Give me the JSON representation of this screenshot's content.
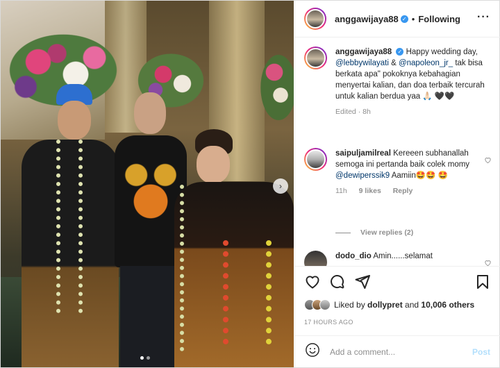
{
  "post": {
    "username": "anggawijaya88",
    "follow_status": "Following",
    "more_icon": "more-horizontal-icon",
    "verified_icon": "verified-badge-icon"
  },
  "caption": {
    "username": "anggawijaya88",
    "text_part1": "Happy wedding day, ",
    "mention1": "@lebbywilayati",
    "text_part2": " & ",
    "mention2": "@napoleon_jr_",
    "text_part3": " tak bisa berkata apa\" pokoknya kebahagian menyertai kalian, dan doa terbaik tercurah untuk kalian berdua yaa 🙏🏻 🖤🖤",
    "meta": "Edited · 8h"
  },
  "comment1": {
    "username": "saipuljamilreal",
    "text_part1": "Kereeen subhanallah semoga ini pertanda baik colek momy ",
    "mention": "@dewiperssik9",
    "text_part2": " Aamiin🤩🤩 🤩",
    "time": "11h",
    "likes": "9 likes",
    "reply": "Reply"
  },
  "view_replies": "View replies (2)",
  "comment2": {
    "username": "dodo_dio",
    "text": "Amin......selamat"
  },
  "likes": {
    "prefix": "Liked by ",
    "user": "dollypret",
    "mid": " and ",
    "count": "10,006 others"
  },
  "timestamp": "17 HOURS AGO",
  "comment_box": {
    "placeholder": "Add a comment...",
    "post_label": "Post",
    "emoji_icon": "smiley-icon"
  },
  "colors": {
    "link": "#00376b",
    "verified": "#3897f0",
    "post_disabled": "#b2dffc",
    "muted": "#8e8e8e"
  }
}
